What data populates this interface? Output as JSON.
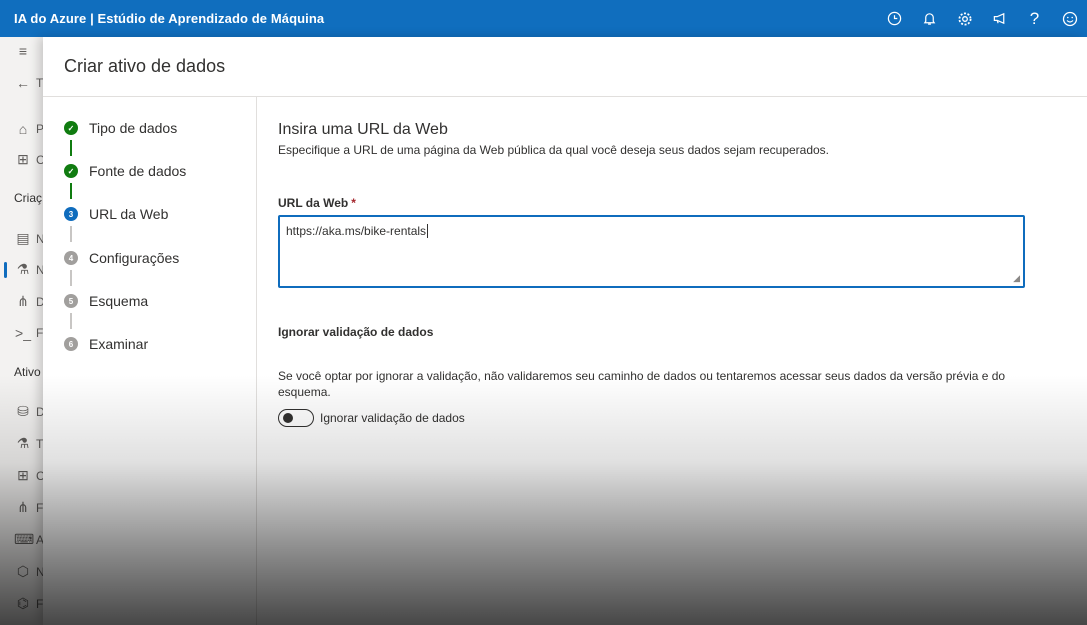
{
  "app": {
    "title": "IA do Azure | Estúdio de Aprendizado de Máquina"
  },
  "topbar_icons": [
    "clock-icon",
    "bell-icon",
    "gear-icon",
    "megaphone-icon",
    "help-icon",
    "smiley-icon"
  ],
  "leftnav": {
    "items": [
      {
        "glyph": "≡",
        "label": ""
      },
      {
        "glyph": "←",
        "label": "T"
      },
      {
        "glyph": "⌂",
        "label": "P"
      },
      {
        "glyph": "⊞",
        "label": "C"
      },
      {
        "glyph": "▤",
        "label": "N"
      },
      {
        "glyph": "⚗",
        "label": "N"
      },
      {
        "glyph": "⋔",
        "label": "D"
      },
      {
        "glyph": ">_",
        "label": "F"
      },
      {
        "glyph": "⛁",
        "label": "D"
      },
      {
        "glyph": "⚗",
        "label": "T"
      },
      {
        "glyph": "⊞",
        "label": "C"
      },
      {
        "glyph": "⋔",
        "label": "F"
      },
      {
        "glyph": "⌨",
        "label": "A"
      },
      {
        "glyph": "⬡",
        "label": "N"
      },
      {
        "glyph": "⌬",
        "label": "F"
      }
    ],
    "sections": [
      "Criaç",
      "Ativo"
    ]
  },
  "panel": {
    "title": "Criar ativo de dados",
    "steps": [
      {
        "num": "✓",
        "label": "Tipo de dados",
        "state": "done"
      },
      {
        "num": "✓",
        "label": "Fonte de dados",
        "state": "done"
      },
      {
        "num": "3",
        "label": "URL da Web",
        "state": "current"
      },
      {
        "num": "4",
        "label": "Configurações",
        "state": "pending"
      },
      {
        "num": "5",
        "label": "Esquema",
        "state": "pending"
      },
      {
        "num": "6",
        "label": "Examinar",
        "state": "pending"
      }
    ],
    "content": {
      "heading": "Insira uma URL da Web",
      "description": "Especifique a URL de uma página da Web pública da qual você deseja seus dados sejam recuperados.",
      "url_label": "URL da Web",
      "required_mark": "*",
      "url_value": "https://aka.ms/bike-rentals",
      "skip_heading": "Ignorar validação de dados",
      "skip_description": "Se você optar por ignorar a validação, não validaremos seu caminho de dados ou tentaremos acessar seus dados da versão prévia e do esquema.",
      "toggle_label": "Ignorar validação de dados",
      "toggle_on": false
    }
  },
  "colors": {
    "topbar": "#106ebe",
    "done": "#107c10",
    "current": "#0f6cbd",
    "pending": "#a19f9d"
  }
}
